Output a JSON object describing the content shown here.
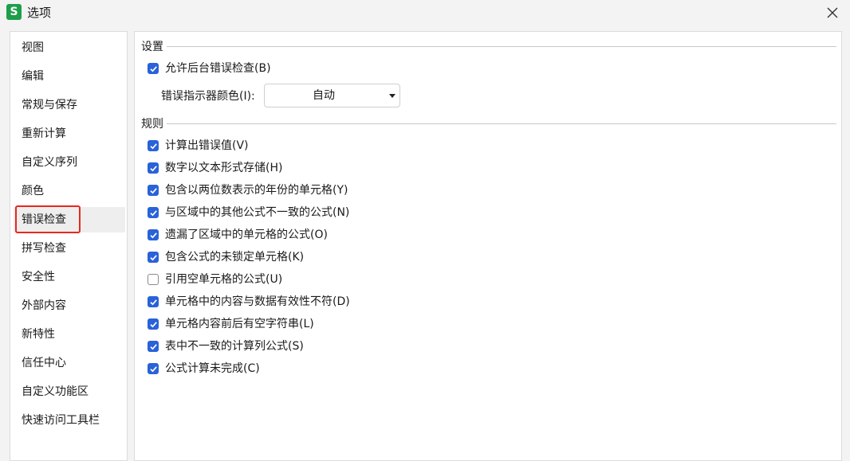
{
  "window": {
    "app_icon_letter": "S",
    "title": "选项"
  },
  "sidebar": {
    "items": [
      {
        "label": "视图"
      },
      {
        "label": "编辑"
      },
      {
        "label": "常规与保存"
      },
      {
        "label": "重新计算"
      },
      {
        "label": "自定义序列"
      },
      {
        "label": "颜色"
      },
      {
        "label": "错误检查",
        "selected": true
      },
      {
        "label": "拼写检查"
      },
      {
        "label": "安全性"
      },
      {
        "label": "外部内容"
      },
      {
        "label": "新特性"
      },
      {
        "label": "信任中心"
      },
      {
        "label": "自定义功能区"
      },
      {
        "label": "快速访问工具栏"
      }
    ]
  },
  "settings": {
    "title": "设置",
    "background_check": {
      "label": "允许后台错误检查(B)",
      "checked": true
    },
    "indicator_color_label": "错误指示器颜色(I):",
    "indicator_color_value": "自动"
  },
  "rules": {
    "title": "规则",
    "items": [
      {
        "label": "计算出错误值(V)",
        "checked": true
      },
      {
        "label": "数字以文本形式存储(H)",
        "checked": true
      },
      {
        "label": "包含以两位数表示的年份的单元格(Y)",
        "checked": true
      },
      {
        "label": "与区域中的其他公式不一致的公式(N)",
        "checked": true
      },
      {
        "label": "遗漏了区域中的单元格的公式(O)",
        "checked": true
      },
      {
        "label": "包含公式的未锁定单元格(K)",
        "checked": true
      },
      {
        "label": "引用空单元格的公式(U)",
        "checked": false
      },
      {
        "label": "单元格中的内容与数据有效性不符(D)",
        "checked": true
      },
      {
        "label": "单元格内容前后有空字符串(L)",
        "checked": true
      },
      {
        "label": "表中不一致的计算列公式(S)",
        "checked": true
      },
      {
        "label": "公式计算未完成(C)",
        "checked": true
      }
    ]
  },
  "colors": {
    "accent": "#2962d9",
    "highlight_border": "#e8281e",
    "app_icon": "#1e9e4a"
  }
}
